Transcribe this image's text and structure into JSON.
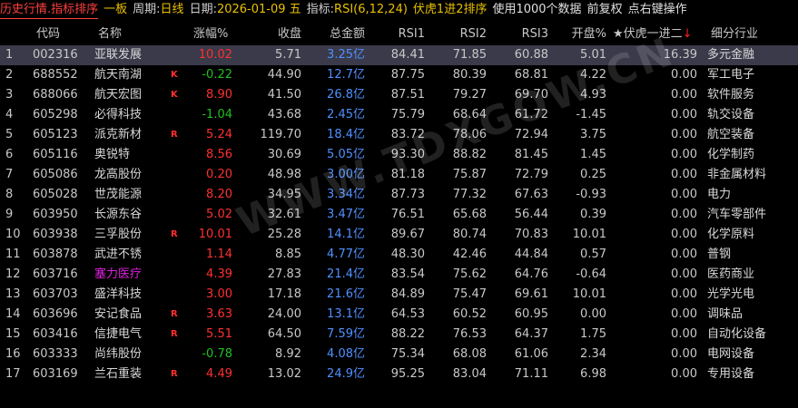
{
  "topbar": {
    "title": "历史行情.指标排序",
    "board": "一板",
    "period_label": "周期:",
    "period_value": "日线",
    "date_label": "日期:",
    "date_value": "2026-01-09 五",
    "indicator_label": "指标:",
    "indicator_value": "RSI(6,12,24)",
    "sort_desc": "伏虎1进2排序",
    "data_info": "使用1000个数据",
    "adjust": "前复权",
    "hint": "点右键操作"
  },
  "columns": {
    "code": "代码",
    "name": "名称",
    "change": "涨幅%",
    "close": "收盘",
    "amount": "总金额",
    "rsi1": "RSI1",
    "rsi2": "RSI2",
    "rsi3": "RSI3",
    "open": "开盘%",
    "fuhu": "★伏虎一进二",
    "sort_arrow": "↓",
    "industry": "细分行业"
  },
  "colors": {
    "up": "#ff3030",
    "down": "#20c020",
    "amount": "#5090ff",
    "title": "#ff4040",
    "accent": "#e8c000",
    "selected_row": "#3a3a4a"
  },
  "watermark": "WWW.TDXGOW.CN",
  "rows": [
    {
      "idx": "1",
      "code": "002316",
      "name": "亚联发展",
      "flag": "",
      "change": "10.02",
      "dir": "up",
      "close": "5.71",
      "amount": "3.25亿",
      "rsi1": "84.41",
      "rsi2": "71.85",
      "rsi3": "60.88",
      "open": "5.01",
      "fuhu": "16.39",
      "industry": "多元金融",
      "selected": true
    },
    {
      "idx": "2",
      "code": "688552",
      "name": "航天南湖",
      "flag": "K",
      "change": "-0.22",
      "dir": "down",
      "close": "44.90",
      "amount": "12.7亿",
      "rsi1": "87.75",
      "rsi2": "80.39",
      "rsi3": "68.81",
      "open": "4.22",
      "fuhu": "0.00",
      "industry": "军工电子"
    },
    {
      "idx": "3",
      "code": "688066",
      "name": "航天宏图",
      "flag": "K",
      "change": "8.90",
      "dir": "up",
      "close": "41.50",
      "amount": "26.8亿",
      "rsi1": "87.51",
      "rsi2": "79.27",
      "rsi3": "69.70",
      "open": "4.93",
      "fuhu": "0.00",
      "industry": "软件服务"
    },
    {
      "idx": "4",
      "code": "605298",
      "name": "必得科技",
      "flag": "",
      "change": "-1.04",
      "dir": "down",
      "close": "43.68",
      "amount": "2.45亿",
      "rsi1": "75.79",
      "rsi2": "68.64",
      "rsi3": "61.72",
      "open": "-1.45",
      "fuhu": "0.00",
      "industry": "轨交设备"
    },
    {
      "idx": "5",
      "code": "605123",
      "name": "派克新材",
      "flag": "R",
      "change": "5.24",
      "dir": "up",
      "close": "119.70",
      "amount": "18.4亿",
      "rsi1": "83.72",
      "rsi2": "78.06",
      "rsi3": "72.94",
      "open": "3.75",
      "fuhu": "0.00",
      "industry": "航空装备"
    },
    {
      "idx": "6",
      "code": "605116",
      "name": "奥锐特",
      "flag": "",
      "change": "8.56",
      "dir": "up",
      "close": "30.69",
      "amount": "5.05亿",
      "rsi1": "93.30",
      "rsi2": "88.82",
      "rsi3": "81.45",
      "open": "1.45",
      "fuhu": "0.00",
      "industry": "化学制药"
    },
    {
      "idx": "7",
      "code": "605086",
      "name": "龙高股份",
      "flag": "",
      "change": "0.20",
      "dir": "up",
      "close": "48.98",
      "amount": "3.00亿",
      "rsi1": "81.18",
      "rsi2": "75.87",
      "rsi3": "72.79",
      "open": "0.25",
      "fuhu": "0.00",
      "industry": "非金属材料"
    },
    {
      "idx": "8",
      "code": "605028",
      "name": "世茂能源",
      "flag": "",
      "change": "8.20",
      "dir": "up",
      "close": "34.95",
      "amount": "3.34亿",
      "rsi1": "87.73",
      "rsi2": "77.32",
      "rsi3": "67.63",
      "open": "-0.93",
      "fuhu": "0.00",
      "industry": "电力"
    },
    {
      "idx": "9",
      "code": "603950",
      "name": "长源东谷",
      "flag": "",
      "change": "5.02",
      "dir": "up",
      "close": "32.61",
      "amount": "3.47亿",
      "rsi1": "76.51",
      "rsi2": "65.68",
      "rsi3": "56.44",
      "open": "0.39",
      "fuhu": "0.00",
      "industry": "汽车零部件"
    },
    {
      "idx": "10",
      "code": "603938",
      "name": "三孚股份",
      "flag": "R",
      "change": "10.01",
      "dir": "up",
      "close": "25.28",
      "amount": "14.1亿",
      "rsi1": "89.67",
      "rsi2": "80.74",
      "rsi3": "70.83",
      "open": "10.01",
      "fuhu": "0.00",
      "industry": "化学原料"
    },
    {
      "idx": "11",
      "code": "603878",
      "name": "武进不锈",
      "flag": "",
      "change": "1.14",
      "dir": "up",
      "close": "8.85",
      "amount": "4.77亿",
      "rsi1": "48.30",
      "rsi2": "42.46",
      "rsi3": "44.84",
      "open": "0.57",
      "fuhu": "0.00",
      "industry": "普钢"
    },
    {
      "idx": "12",
      "code": "603716",
      "name": "塞力医疗",
      "flag": "",
      "mag": true,
      "change": "4.39",
      "dir": "up",
      "close": "27.83",
      "amount": "21.4亿",
      "rsi1": "83.54",
      "rsi2": "75.62",
      "rsi3": "64.76",
      "open": "-0.64",
      "fuhu": "0.00",
      "industry": "医药商业"
    },
    {
      "idx": "13",
      "code": "603703",
      "name": "盛洋科技",
      "flag": "",
      "change": "3.00",
      "dir": "up",
      "close": "17.18",
      "amount": "21.6亿",
      "rsi1": "84.89",
      "rsi2": "75.47",
      "rsi3": "69.61",
      "open": "10.01",
      "fuhu": "0.00",
      "industry": "光学光电"
    },
    {
      "idx": "14",
      "code": "603696",
      "name": "安记食品",
      "flag": "R",
      "change": "3.63",
      "dir": "up",
      "close": "24.00",
      "amount": "13.1亿",
      "rsi1": "64.53",
      "rsi2": "60.52",
      "rsi3": "60.95",
      "open": "0.00",
      "fuhu": "0.00",
      "industry": "调味品"
    },
    {
      "idx": "15",
      "code": "603416",
      "name": "信捷电气",
      "flag": "R",
      "change": "5.51",
      "dir": "up",
      "close": "64.50",
      "amount": "7.59亿",
      "rsi1": "88.22",
      "rsi2": "76.53",
      "rsi3": "64.37",
      "open": "1.75",
      "fuhu": "0.00",
      "industry": "自动化设备"
    },
    {
      "idx": "16",
      "code": "603333",
      "name": "尚纬股份",
      "flag": "",
      "change": "-0.78",
      "dir": "down",
      "close": "8.92",
      "amount": "4.08亿",
      "rsi1": "75.34",
      "rsi2": "68.08",
      "rsi3": "61.06",
      "open": "2.34",
      "fuhu": "0.00",
      "industry": "电网设备"
    },
    {
      "idx": "17",
      "code": "603169",
      "name": "兰石重装",
      "flag": "R",
      "change": "4.49",
      "dir": "up",
      "close": "13.02",
      "amount": "24.9亿",
      "rsi1": "95.25",
      "rsi2": "83.04",
      "rsi3": "71.11",
      "open": "6.98",
      "fuhu": "0.00",
      "industry": "专用设备"
    }
  ]
}
